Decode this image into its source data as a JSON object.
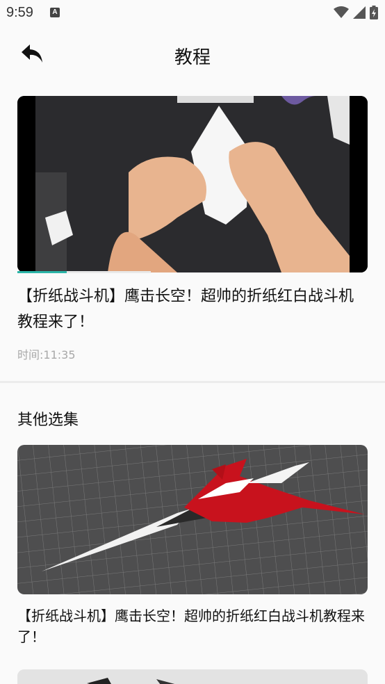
{
  "status_bar": {
    "time": "9:59",
    "notification_icon_letter": "A",
    "icons": [
      "wifi-icon",
      "signal-icon",
      "battery-charging-icon"
    ]
  },
  "header": {
    "title": "教程",
    "back_icon": "back-arrow-icon"
  },
  "video": {
    "title": "【折纸战斗机】鹰击长空！超帅的折纸红白战斗机教程来了！",
    "time": "时间:11:35",
    "progress": 0.14,
    "buffered": 0.38
  },
  "episodes": {
    "section_title": "其他选集",
    "items": [
      {
        "title": "【折纸战斗机】鹰击长空！超帅的折纸红白战斗机教程来了！"
      }
    ]
  },
  "colors": {
    "accent": "#2bb5a8",
    "muted_text": "#a8a8a8",
    "divider": "#ececec"
  }
}
